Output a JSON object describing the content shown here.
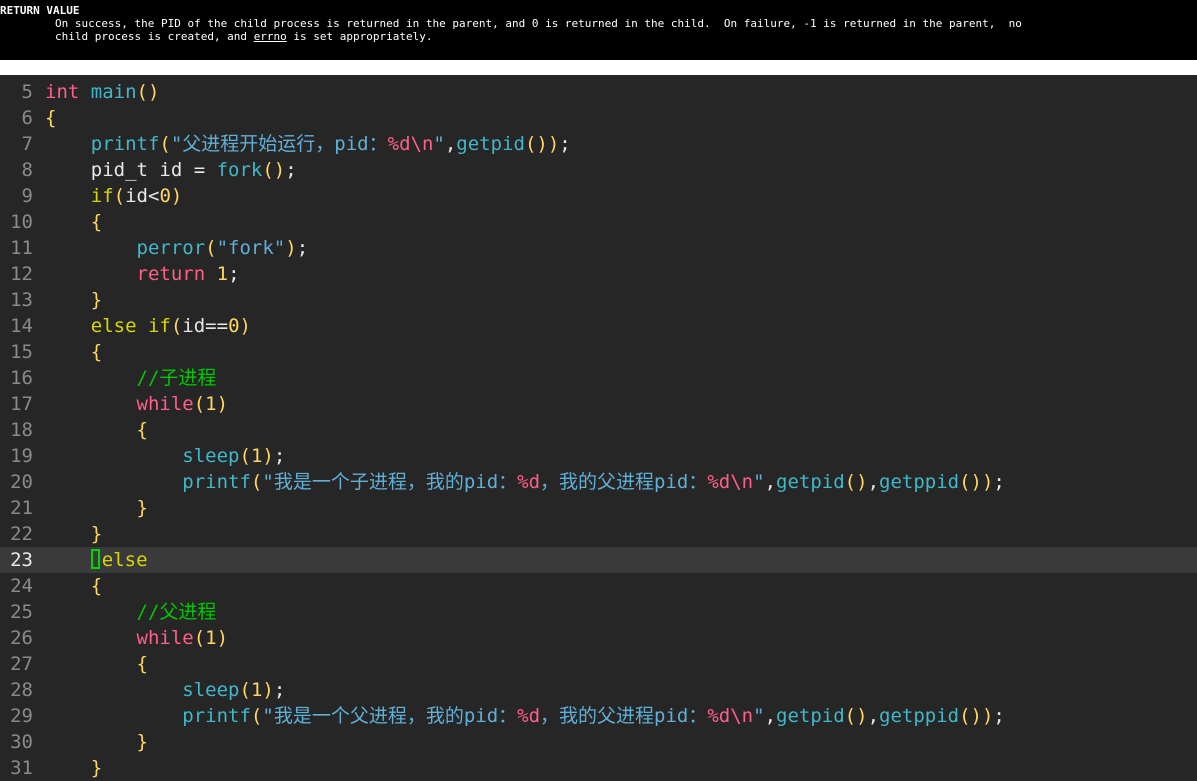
{
  "man": {
    "heading": "RETURN VALUE",
    "line1": "On success, the PID of the child process is returned in the parent, and 0 is returned in the child.  On failure, -1 is returned in the parent,  no",
    "line2_pre": "child process is created, and ",
    "line2_ul": "errno",
    "line2_post": " is set appropriately."
  },
  "editor": {
    "current_line": 23,
    "lines": [
      {
        "n": "5",
        "t": [
          [
            "int",
            "kw"
          ],
          [
            " ",
            "pl"
          ],
          [
            "main",
            "fn"
          ],
          [
            "()",
            "brk"
          ]
        ]
      },
      {
        "n": "6",
        "t": [
          [
            "{",
            "brk"
          ]
        ]
      },
      {
        "n": "7",
        "t": [
          [
            "    ",
            "pl"
          ],
          [
            "printf",
            "fn"
          ],
          [
            "(",
            "brk"
          ],
          [
            "\"父进程开始运行，pid：",
            "str"
          ],
          [
            "%d\\n",
            "fmt"
          ],
          [
            "\"",
            "str"
          ],
          [
            ",",
            "pl"
          ],
          [
            "getpid",
            "fn"
          ],
          [
            "())",
            "brk"
          ],
          [
            ";",
            "pl"
          ]
        ]
      },
      {
        "n": "8",
        "t": [
          [
            "    pid_t id = ",
            "pl"
          ],
          [
            "fork",
            "fn"
          ],
          [
            "()",
            "brk"
          ],
          [
            ";",
            "pl"
          ]
        ]
      },
      {
        "n": "9",
        "t": [
          [
            "    ",
            "pl"
          ],
          [
            "if",
            "ctrl"
          ],
          [
            "(",
            "brk"
          ],
          [
            "id<",
            "pl"
          ],
          [
            "0",
            "num"
          ],
          [
            ")",
            "brk"
          ]
        ]
      },
      {
        "n": "10",
        "t": [
          [
            "    ",
            "pl"
          ],
          [
            "{",
            "brk"
          ]
        ]
      },
      {
        "n": "11",
        "t": [
          [
            "        ",
            "pl"
          ],
          [
            "perror",
            "fn"
          ],
          [
            "(",
            "brk"
          ],
          [
            "\"fork\"",
            "str"
          ],
          [
            ")",
            "brk"
          ],
          [
            ";",
            "pl"
          ]
        ]
      },
      {
        "n": "12",
        "t": [
          [
            "        ",
            "pl"
          ],
          [
            "return",
            "kw"
          ],
          [
            " ",
            "pl"
          ],
          [
            "1",
            "num"
          ],
          [
            ";",
            "pl"
          ]
        ]
      },
      {
        "n": "13",
        "t": [
          [
            "    ",
            "pl"
          ],
          [
            "}",
            "brk"
          ]
        ]
      },
      {
        "n": "14",
        "t": [
          [
            "    ",
            "pl"
          ],
          [
            "else if",
            "ctrl"
          ],
          [
            "(",
            "brk"
          ],
          [
            "id==",
            "pl"
          ],
          [
            "0",
            "num"
          ],
          [
            ")",
            "brk"
          ]
        ]
      },
      {
        "n": "15",
        "t": [
          [
            "    ",
            "pl"
          ],
          [
            "{",
            "brk"
          ]
        ]
      },
      {
        "n": "16",
        "t": [
          [
            "        ",
            "pl"
          ],
          [
            "//子进程",
            "cmt"
          ]
        ]
      },
      {
        "n": "17",
        "t": [
          [
            "        ",
            "pl"
          ],
          [
            "while",
            "kw"
          ],
          [
            "(",
            "brk"
          ],
          [
            "1",
            "num"
          ],
          [
            ")",
            "brk"
          ]
        ]
      },
      {
        "n": "18",
        "t": [
          [
            "        ",
            "pl"
          ],
          [
            "{",
            "brk"
          ]
        ]
      },
      {
        "n": "19",
        "t": [
          [
            "            ",
            "pl"
          ],
          [
            "sleep",
            "fn"
          ],
          [
            "(",
            "brk"
          ],
          [
            "1",
            "num"
          ],
          [
            ")",
            "brk"
          ],
          [
            ";",
            "pl"
          ]
        ]
      },
      {
        "n": "20",
        "t": [
          [
            "            ",
            "pl"
          ],
          [
            "printf",
            "fn"
          ],
          [
            "(",
            "brk"
          ],
          [
            "\"我是一个子进程，我的pid：",
            "str"
          ],
          [
            "%d",
            "fmt"
          ],
          [
            "，我的父进程pid：",
            "str"
          ],
          [
            "%d\\n",
            "fmt"
          ],
          [
            "\"",
            "str"
          ],
          [
            ",",
            "pl"
          ],
          [
            "getpid",
            "fn"
          ],
          [
            "()",
            "brk"
          ],
          [
            ",",
            "pl"
          ],
          [
            "getppid",
            "fn"
          ],
          [
            "())",
            "brk"
          ],
          [
            ";",
            "pl"
          ]
        ]
      },
      {
        "n": "21",
        "t": [
          [
            "        ",
            "pl"
          ],
          [
            "}",
            "brk"
          ]
        ]
      },
      {
        "n": "22",
        "t": [
          [
            "    ",
            "pl"
          ],
          [
            "}",
            "brk"
          ]
        ]
      },
      {
        "n": "23",
        "t": [
          [
            "    ",
            "pl"
          ],
          [
            "",
            "cursor"
          ],
          [
            "else",
            "ctrl"
          ]
        ]
      },
      {
        "n": "24",
        "t": [
          [
            "    ",
            "pl"
          ],
          [
            "{",
            "brk"
          ]
        ]
      },
      {
        "n": "25",
        "t": [
          [
            "        ",
            "pl"
          ],
          [
            "//父进程",
            "cmt"
          ]
        ]
      },
      {
        "n": "26",
        "t": [
          [
            "        ",
            "pl"
          ],
          [
            "while",
            "kw"
          ],
          [
            "(",
            "brk"
          ],
          [
            "1",
            "num"
          ],
          [
            ")",
            "brk"
          ]
        ]
      },
      {
        "n": "27",
        "t": [
          [
            "        ",
            "pl"
          ],
          [
            "{",
            "brk"
          ]
        ]
      },
      {
        "n": "28",
        "t": [
          [
            "            ",
            "pl"
          ],
          [
            "sleep",
            "fn"
          ],
          [
            "(",
            "brk"
          ],
          [
            "1",
            "num"
          ],
          [
            ")",
            "brk"
          ],
          [
            ";",
            "pl"
          ]
        ]
      },
      {
        "n": "29",
        "t": [
          [
            "            ",
            "pl"
          ],
          [
            "printf",
            "fn"
          ],
          [
            "(",
            "brk"
          ],
          [
            "\"我是一个父进程，我的pid：",
            "str"
          ],
          [
            "%d",
            "fmt"
          ],
          [
            "，我的父进程pid：",
            "str"
          ],
          [
            "%d\\n",
            "fmt"
          ],
          [
            "\"",
            "str"
          ],
          [
            ",",
            "pl"
          ],
          [
            "getpid",
            "fn"
          ],
          [
            "()",
            "brk"
          ],
          [
            ",",
            "pl"
          ],
          [
            "getppid",
            "fn"
          ],
          [
            "())",
            "brk"
          ],
          [
            ";",
            "pl"
          ]
        ]
      },
      {
        "n": "30",
        "t": [
          [
            "        ",
            "pl"
          ],
          [
            "}",
            "brk"
          ]
        ]
      },
      {
        "n": "31",
        "t": [
          [
            "    ",
            "pl"
          ],
          [
            "}",
            "brk"
          ]
        ]
      }
    ]
  }
}
